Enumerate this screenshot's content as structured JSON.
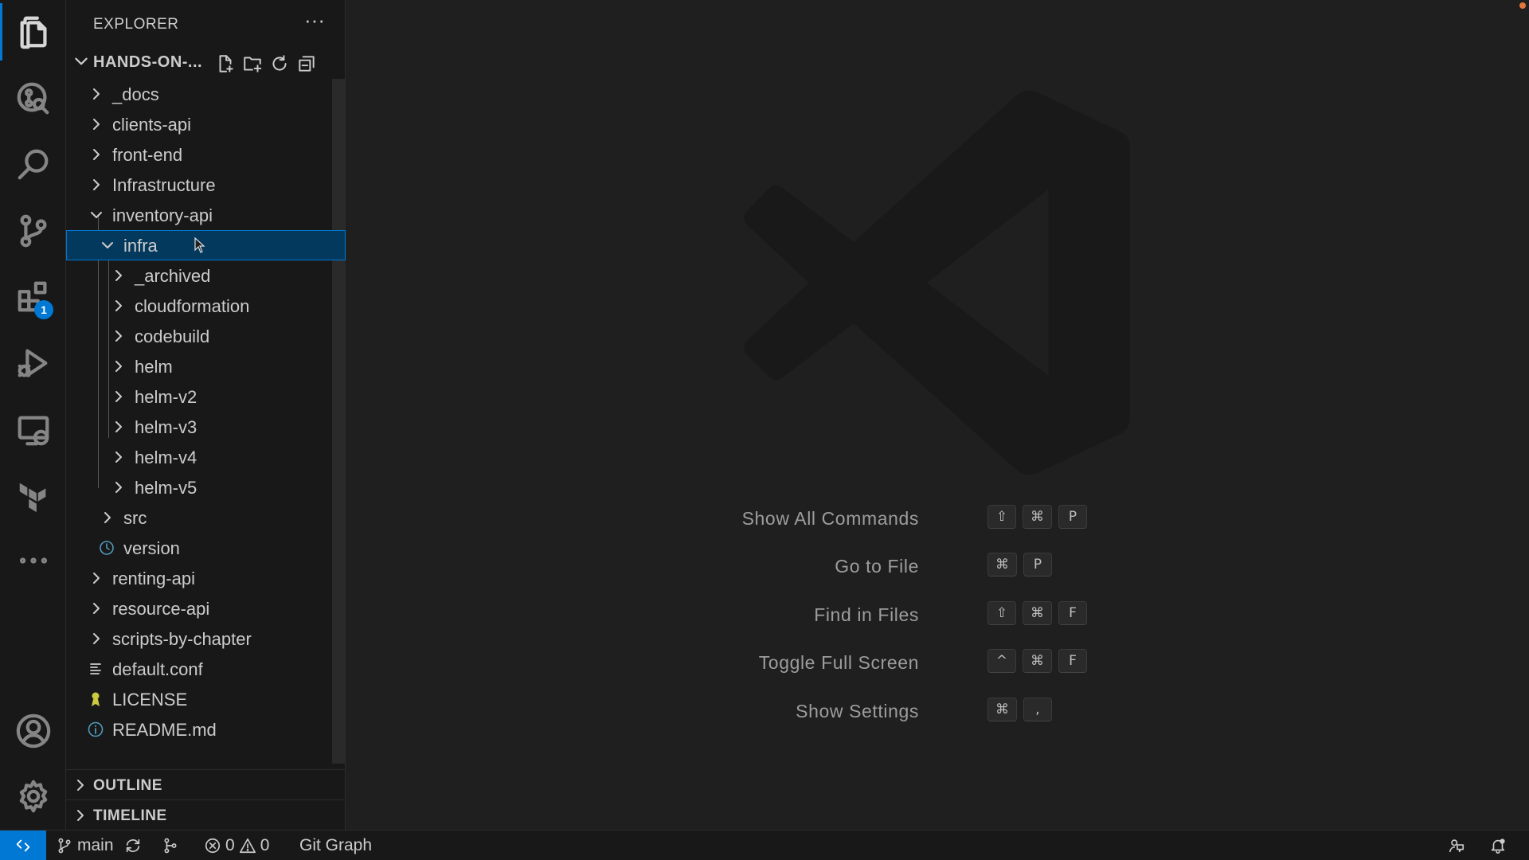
{
  "sidebar": {
    "title": "EXPLORER",
    "more_label": "···",
    "folder_name": "HANDS-ON-...",
    "tree": [
      {
        "label": "_docs",
        "kind": "folder",
        "expanded": false
      },
      {
        "label": "clients-api",
        "kind": "folder",
        "expanded": false
      },
      {
        "label": "front-end",
        "kind": "folder",
        "expanded": false
      },
      {
        "label": "Infrastructure",
        "kind": "folder",
        "expanded": false
      },
      {
        "label": "inventory-api",
        "kind": "folder",
        "expanded": true
      },
      {
        "label": "infra",
        "kind": "folder",
        "expanded": true,
        "selected": true
      },
      {
        "label": "_archived",
        "kind": "folder",
        "expanded": false
      },
      {
        "label": "cloudformation",
        "kind": "folder",
        "expanded": false
      },
      {
        "label": "codebuild",
        "kind": "folder",
        "expanded": false
      },
      {
        "label": "helm",
        "kind": "folder",
        "expanded": false
      },
      {
        "label": "helm-v2",
        "kind": "folder",
        "expanded": false
      },
      {
        "label": "helm-v3",
        "kind": "folder",
        "expanded": false
      },
      {
        "label": "helm-v4",
        "kind": "folder",
        "expanded": false
      },
      {
        "label": "helm-v5",
        "kind": "folder",
        "expanded": false
      },
      {
        "label": "src",
        "kind": "folder",
        "expanded": false
      },
      {
        "label": "version",
        "kind": "file",
        "icon": "clock-icon"
      },
      {
        "label": "renting-api",
        "kind": "folder",
        "expanded": false
      },
      {
        "label": "resource-api",
        "kind": "folder",
        "expanded": false
      },
      {
        "label": "scripts-by-chapter",
        "kind": "folder",
        "expanded": false
      },
      {
        "label": "default.conf",
        "kind": "file",
        "icon": "lines-icon"
      },
      {
        "label": "LICENSE",
        "kind": "file",
        "icon": "license-icon"
      },
      {
        "label": "README.md",
        "kind": "file",
        "icon": "info-icon"
      }
    ],
    "sections": [
      {
        "label": "OUTLINE"
      },
      {
        "label": "TIMELINE"
      }
    ]
  },
  "activity_bar": {
    "extensions_badge": "1"
  },
  "editor": {
    "shortcuts": [
      {
        "label": "Show All Commands",
        "keys": [
          "⇧",
          "⌘",
          "P"
        ]
      },
      {
        "label": "Go to File",
        "keys": [
          "⌘",
          "P"
        ]
      },
      {
        "label": "Find in Files",
        "keys": [
          "⇧",
          "⌘",
          "F"
        ]
      },
      {
        "label": "Toggle Full Screen",
        "keys": [
          "^",
          "⌘",
          "F"
        ]
      },
      {
        "label": "Show Settings",
        "keys": [
          "⌘",
          ","
        ]
      }
    ]
  },
  "status_bar": {
    "branch": "main",
    "errors": "0",
    "warnings": "0",
    "git_graph": "Git Graph"
  },
  "colors": {
    "accent": "#0078d4",
    "background": "#1f1f1f",
    "sidebar": "#181818",
    "selection": "#04395e"
  }
}
